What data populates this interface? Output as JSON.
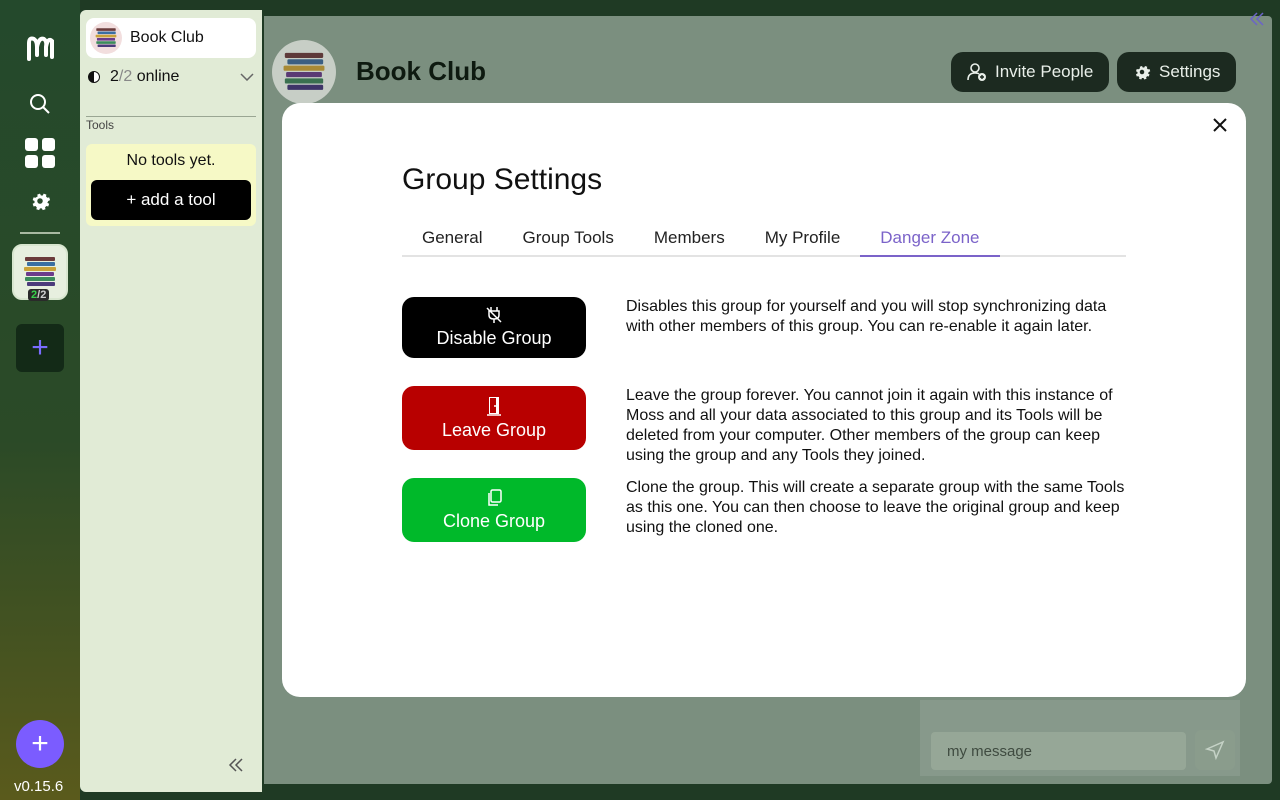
{
  "rail": {
    "online_count": "2",
    "total_count": "2",
    "version": "v0.15.6"
  },
  "sidebar": {
    "group_name": "Book Club",
    "online_count": "2",
    "total_count": "2",
    "online_label": "online",
    "tools_label": "Tools",
    "no_tools": "No tools yet.",
    "add_tool": "+ add a tool"
  },
  "header": {
    "title": "Book Club",
    "invite_label": "Invite People",
    "settings_label": "Settings"
  },
  "chat": {
    "placeholder": "my message"
  },
  "modal": {
    "title": "Group Settings",
    "tabs": [
      {
        "label": "General"
      },
      {
        "label": "Group Tools"
      },
      {
        "label": "Members"
      },
      {
        "label": "My Profile"
      },
      {
        "label": "Danger Zone"
      }
    ],
    "actions": [
      {
        "label": "Disable Group",
        "color": "#000000",
        "icon": "plug-off-icon",
        "description": "Disables this group for yourself and you will stop synchronizing data with other members of this group. You can re-enable it again later."
      },
      {
        "label": "Leave Group",
        "color": "#b80000",
        "icon": "door-exit-icon",
        "description": "Leave the group forever. You cannot join it again with this instance of Moss and all your data associated to this group and its Tools will be deleted from your computer. Other members of the group can keep using the group and any Tools they joined."
      },
      {
        "label": "Clone Group",
        "color": "#00b92a",
        "icon": "copy-icon",
        "description": "Clone the group. This will create a separate group with the same Tools as this one. You can then choose to leave the original group and keep using the cloned one."
      }
    ]
  },
  "colors": {
    "accent": "#7b63c9"
  }
}
